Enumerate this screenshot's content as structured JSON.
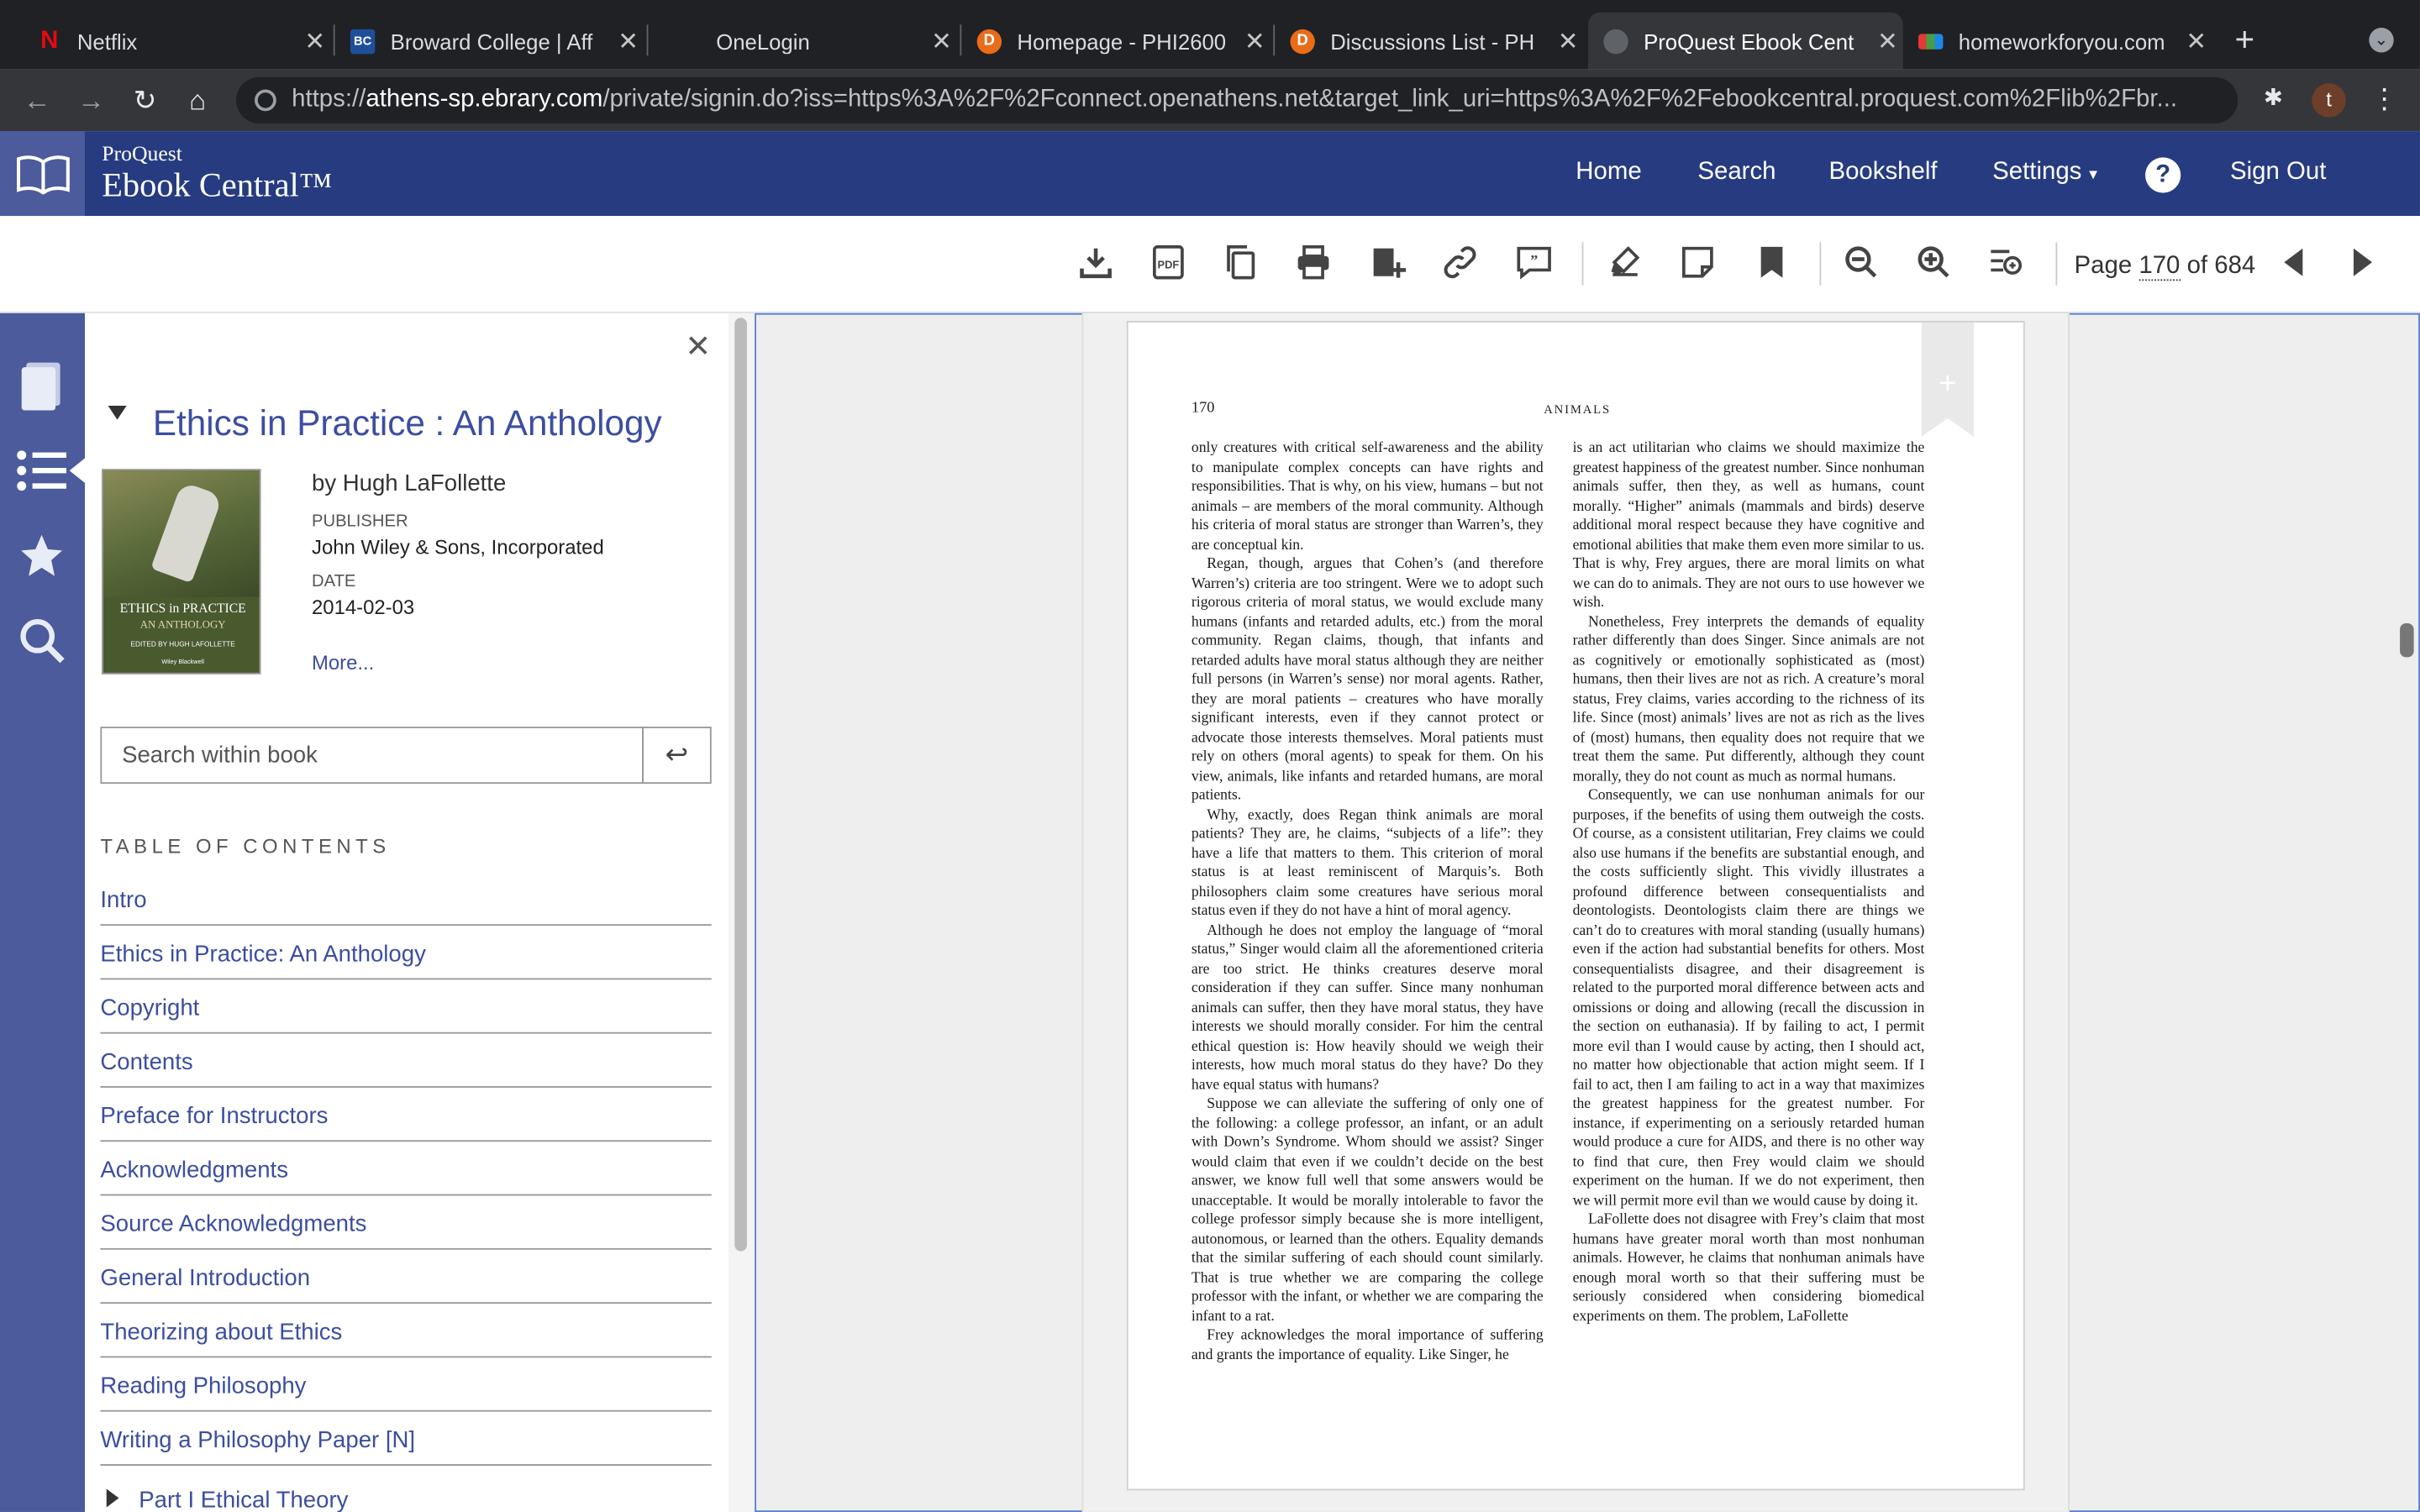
{
  "tabs": [
    {
      "title": "Netflix",
      "favicon": "netflix-icon"
    },
    {
      "title": "Broward College | Aff",
      "favicon": "bc-icon"
    },
    {
      "title": "OneLogin",
      "favicon": "onelogin-icon"
    },
    {
      "title": "Homepage - PHI2600",
      "favicon": "d2l-icon"
    },
    {
      "title": "Discussions List - PH",
      "favicon": "d2l-icon"
    },
    {
      "title": "ProQuest Ebook Cent",
      "favicon": "globe-icon"
    },
    {
      "title": "homeworkforyou.com",
      "favicon": "hw-icon"
    }
  ],
  "browser": {
    "url_scheme": "https://",
    "url_host": "athens-sp.ebrary.com",
    "url_path": "/private/signin.do?iss=https%3A%2F%2Fconnect.openathens.net&target_link_uri=https%3A%2F%2Febookcentral.proquest.com%2Flib%2Fbr...",
    "profile_initial": "t"
  },
  "header": {
    "brand_top": "ProQuest",
    "brand_main": "Ebook Central™",
    "nav": [
      "Home",
      "Search",
      "Bookshelf",
      "Settings",
      "Sign Out"
    ]
  },
  "toolbar": {
    "page_label": "Page",
    "page_current": "170",
    "page_of": "of 684"
  },
  "book": {
    "title": "Ethics in Practice : An Anthology",
    "author": "by Hugh LaFollette",
    "publisher_label": "PUBLISHER",
    "publisher": "John Wiley & Sons, Incorporated",
    "date_label": "DATE",
    "date": "2014-02-03",
    "more": "More...",
    "cover_title1": "ETHICS in PRACTICE",
    "cover_title2": "AN ANTHOLOGY",
    "cover_editor": "EDITED BY HUGH LAFOLLETTE",
    "cover_publisher": "Wiley Blackwell"
  },
  "search": {
    "placeholder": "Search within book"
  },
  "toc": {
    "heading": "TABLE OF CONTENTS",
    "items": [
      "Intro",
      "Ethics in Practice: An Anthology",
      "Copyright",
      "Contents",
      "Preface for Instructors",
      "Acknowledgments",
      "Source Acknowledgments",
      "General Introduction",
      "Theorizing about Ethics",
      "Reading Philosophy",
      "Writing a Philosophy Paper [N]"
    ],
    "part": "Part I Ethical Theory"
  },
  "page": {
    "number": "170",
    "running_head": "ANIMALS",
    "left_column": [
      "only creatures with critical self-awareness and the ability to manipulate complex concepts can have rights and responsibilities. That is why, on his view, humans – but not animals – are members of the moral community. Although his criteria of moral status are stronger than Warren’s, they are conceptual kin.",
      "Regan, though, argues that Cohen’s (and therefore Warren’s) criteria are too stringent. Were we to adopt such rigorous criteria of moral status, we would exclude many humans (infants and retarded adults, etc.) from the moral community. Regan claims, though, that infants and retarded adults have moral status although they are neither full persons (in Warren’s sense) nor moral agents. Rather, they are moral patients – creatures who have morally significant interests, even if they cannot protect or advocate those interests themselves. Moral patients must rely on others (moral agents) to speak for them. On his view, animals, like infants and retarded humans, are moral patients.",
      "Why, exactly, does Regan think animals are moral patients? They are, he claims, “subjects of a life”: they have a life that matters to them. This criterion of moral status is at least reminiscent of Marquis’s. Both philosophers claim some creatures have serious moral status even if they do not have a hint of moral agency.",
      "Although he does not employ the language of “moral status,” Singer would claim all the aforementioned criteria are too strict. He thinks creatures deserve moral consideration if they can suffer. Since many nonhuman animals can suffer, then they have moral status, they have interests we should morally consider. For him the central ethical question is: How heavily should we weigh their interests, how much moral status do they have? Do they have equal status with humans?",
      "Suppose we can alleviate the suffering of only one of the following: a college professor, an infant, or an adult with Down’s Syndrome. Whom should we assist? Singer would claim that even if we couldn’t decide on the best answer, we know full well that some answers would be unacceptable. It would be morally intolerable to favor the college professor simply because she is more intelligent, autonomous, or learned than the others. Equality demands that the similar suffering of each should count similarly. That is true whether we are comparing the college professor with the infant, or whether we are comparing the infant to a rat.",
      "Frey acknowledges the moral importance of suffering and grants the importance of equality. Like Singer, he"
    ],
    "right_column": [
      "is an act utilitarian who claims we should maximize the greatest happiness of the greatest number. Since nonhuman animals suffer, then they, as well as humans, count morally. “Higher” animals (mammals and birds) deserve additional moral respect because they have cognitive and emotional abilities that make them even more similar to us. That is why, Frey argues, there are moral limits on what we can do to animals. They are not ours to use however we wish.",
      "Nonetheless, Frey interprets the demands of equality rather differently than does Singer. Since animals are not as cognitively or emotionally sophisticated as (most) humans, then their lives are not as rich. A creature’s moral status, Frey claims, varies according to the richness of its life. Since (most) animals’ lives are not as rich as the lives of (most) humans, then equality does not require that we treat them the same. Put differently, although they count morally, they do not count as much as normal humans.",
      "Consequently, we can use nonhuman animals for our purposes, if the benefits of using them outweigh the costs. Of course, as a consistent utilitarian, Frey claims we could also use humans if the benefits are substantial enough, and the costs sufficiently slight. This vividly illustrates a profound difference between consequentialists and deontologists. Deontologists claim there are things we can’t do to creatures with moral standing (usually humans) even if the action had substantial benefits for others. Most consequentialists disagree, and their disagreement is related to the purported moral difference between acts and omissions or doing and allowing (recall the discussion in the section on euthanasia). If by failing to act, I permit more evil than I would cause by acting, then I should act, no matter how objectionable that action might seem. If I fail to act, then I am failing to act in a way that maximizes the greatest happiness for the greatest number. For instance, if experimenting on a seriously retarded human would produce a cure for AIDS, and there is no other way to find that cure, then Frey would claim we should experiment on the human. If we do not experiment, then we will permit more evil than we would cause by doing it.",
      "LaFollette does not disagree with Frey’s claim that most humans have greater moral worth than most nonhuman animals. However, he claims that nonhuman animals have enough moral worth so that their suffering must be seriously considered when considering biomedical experiments on them. The problem, LaFollette"
    ]
  }
}
